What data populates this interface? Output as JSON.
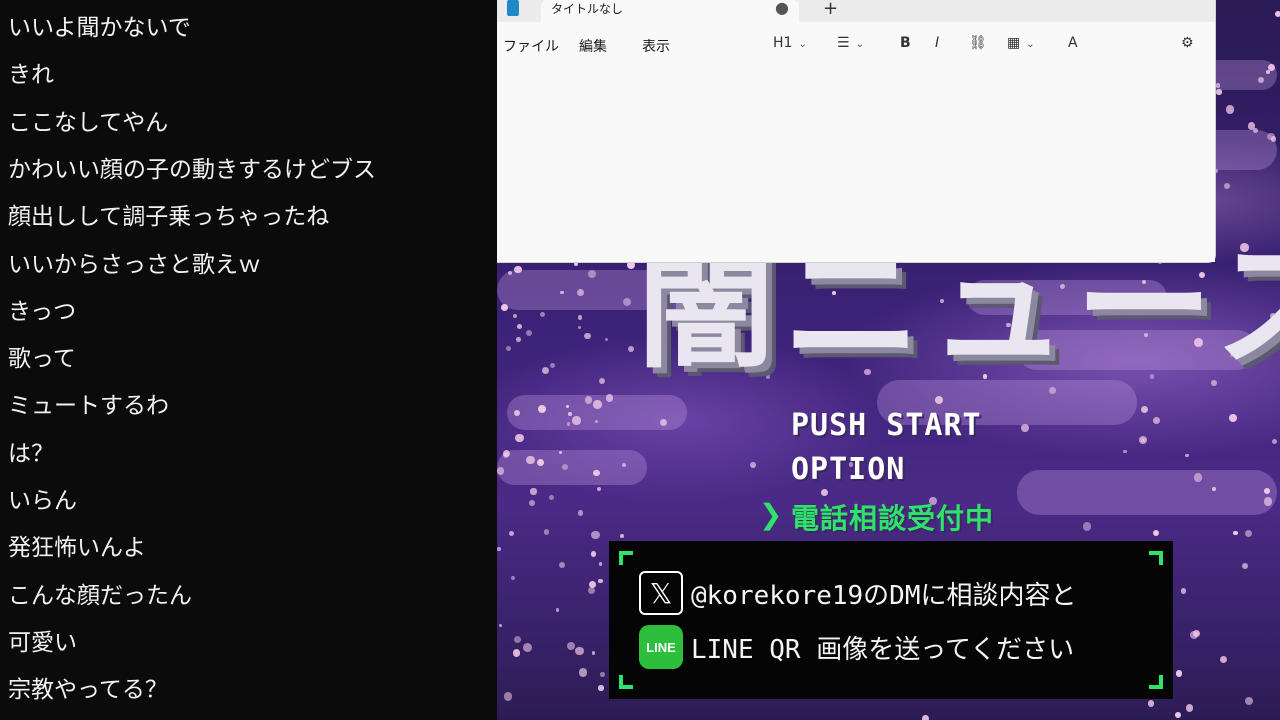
{
  "chat": {
    "messages": [
      "いいよ聞かないで",
      "きれ",
      "ここなしてやん",
      "かわいい顔の子の動きするけどブス",
      "顔出しして調子乗っちゃったね",
      "いいからさっさと歌えｗ",
      "きっつ",
      "歌って",
      "ミュートするわ",
      "は？",
      "いらん",
      "発狂怖いんよ",
      "こんな顔だったん",
      "可愛い",
      "宗教やってる？"
    ]
  },
  "notepad": {
    "tab_title": "タイトルなし",
    "new_tab": "+",
    "menus": {
      "file": "ファイル",
      "edit": "編集",
      "view": "表示"
    },
    "toolbar": {
      "heading": "H1",
      "list": "☰",
      "bold": "B",
      "italic": "I",
      "link": "⛓",
      "table": "▦",
      "spell": "A",
      "settings": "⚙"
    }
  },
  "game": {
    "title": "闇ニュース",
    "menu": {
      "start": "PUSH START",
      "option": "OPTION",
      "phone": "電話相談受付中",
      "cursor": "❯"
    },
    "info": {
      "x_icon": "𝕏",
      "line1": "@korekore19のDMに相談内容と",
      "line_icon": "LINE",
      "line2": "LINE QR 画像を送ってください"
    },
    "colors": {
      "accent": "#2ee36a",
      "box": "#050505",
      "sky": "#3c2278"
    }
  }
}
